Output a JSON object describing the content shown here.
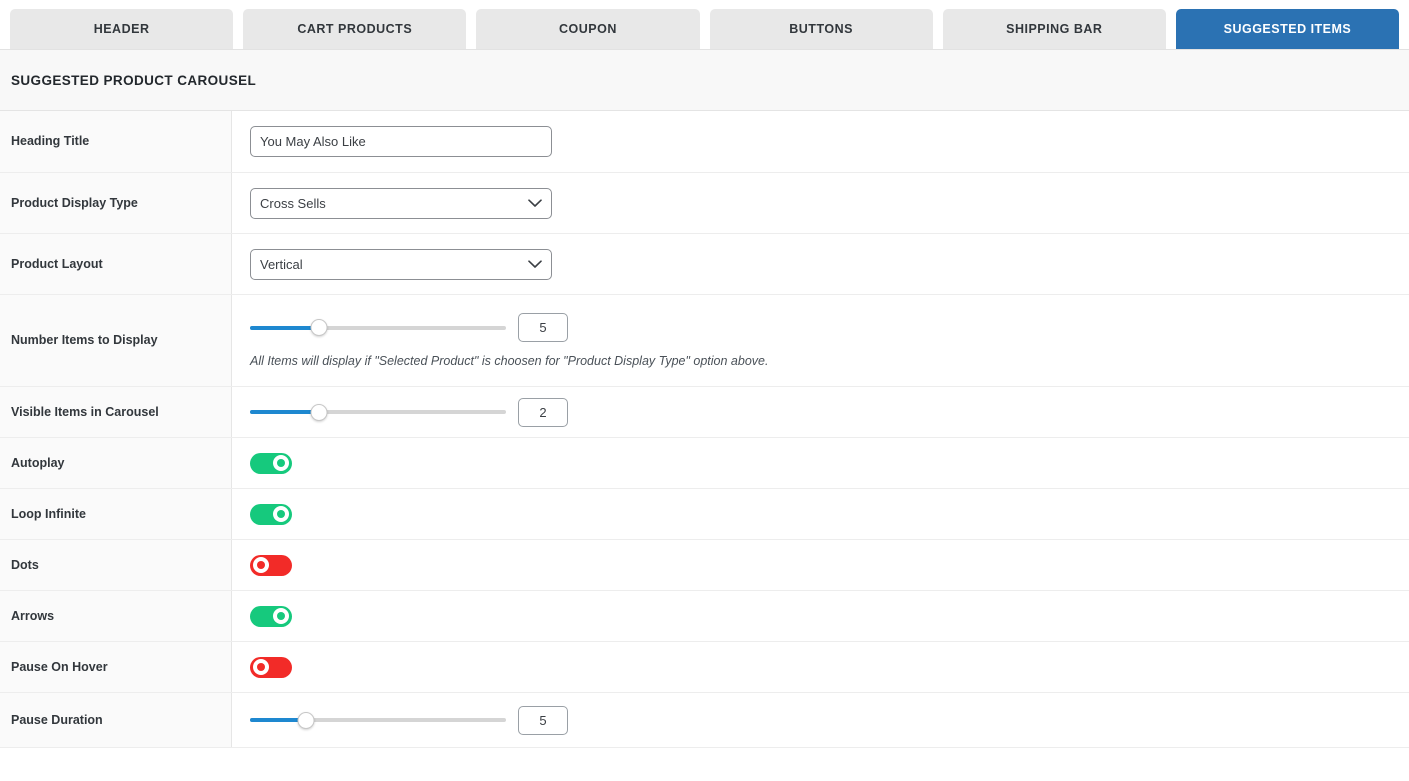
{
  "tabs": [
    {
      "label": "HEADER",
      "active": false
    },
    {
      "label": "CART PRODUCTS",
      "active": false
    },
    {
      "label": "COUPON",
      "active": false
    },
    {
      "label": "BUTTONS",
      "active": false
    },
    {
      "label": "SHIPPING BAR",
      "active": false
    },
    {
      "label": "SUGGESTED ITEMS",
      "active": true
    }
  ],
  "section": {
    "title": "SUGGESTED PRODUCT CAROUSEL"
  },
  "colors": {
    "tab_active_bg": "#2b72b3",
    "tab_inactive_bg": "#e8e8e8",
    "toggle_on": "#16c97d",
    "toggle_off": "#f22b28",
    "slider_fill": "#1e88d0",
    "slider_track": "#d5d5d5"
  },
  "rows": {
    "heading_title": {
      "label": "Heading Title",
      "value": "You May Also Like",
      "placeholder": "You May Also Like"
    },
    "product_display_type": {
      "label": "Product Display Type",
      "value": "Cross Sells",
      "options": [
        "Cross Sells"
      ],
      "icon": "chevron-down-icon"
    },
    "product_layout": {
      "label": "Product Layout",
      "value": "Vertical",
      "options": [
        "Vertical"
      ],
      "icon": "chevron-down-icon"
    },
    "number_items_to_display": {
      "label": "Number Items to Display",
      "value": "5",
      "slider_percent": 27,
      "note": "All Items will display if \"Selected Product\" is choosen for \"Product Display Type\" option above."
    },
    "visible_items_in_carousel": {
      "label": "Visible Items in Carousel",
      "value": "2",
      "slider_percent": 27
    },
    "autoplay": {
      "label": "Autoplay",
      "state": "on"
    },
    "loop_infinite": {
      "label": "Loop Infinite",
      "state": "on"
    },
    "dots": {
      "label": "Dots",
      "state": "off"
    },
    "arrows": {
      "label": "Arrows",
      "state": "on"
    },
    "pause_on_hover": {
      "label": "Pause On Hover",
      "state": "off"
    },
    "pause_duration": {
      "label": "Pause Duration",
      "value": "5",
      "slider_percent": 22
    }
  }
}
